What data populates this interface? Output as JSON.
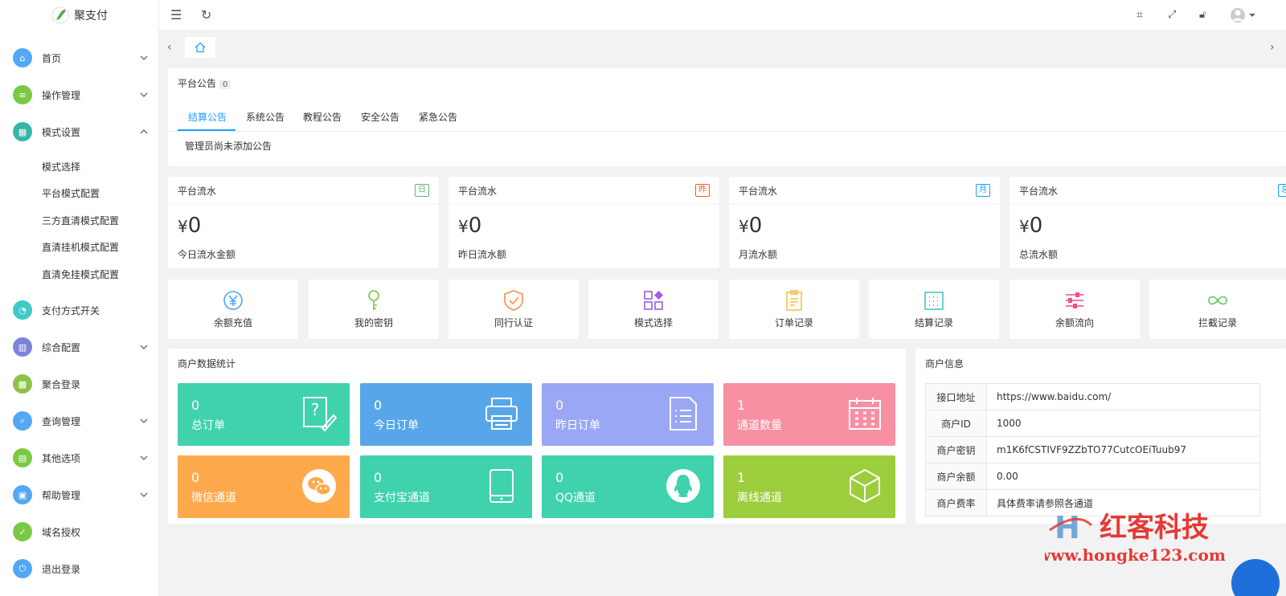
{
  "app": {
    "name": "聚支付"
  },
  "sidebar": {
    "items": [
      {
        "label": "首页",
        "color": "#52a8f5",
        "glyph": "⌂",
        "chevron": "down"
      },
      {
        "label": "操作管理",
        "color": "#7ac943",
        "glyph": "≡",
        "chevron": "down"
      },
      {
        "label": "模式设置",
        "color": "#36b5a8",
        "glyph": "▦",
        "chevron": "up"
      },
      {
        "label": "支付方式开关",
        "color": "#3fc9c9",
        "glyph": "◔",
        "chevron": ""
      },
      {
        "label": "综合配置",
        "color": "#7b84d9",
        "glyph": "▥",
        "chevron": "down"
      },
      {
        "label": "聚合登录",
        "color": "#8bc34a",
        "glyph": "▩",
        "chevron": ""
      },
      {
        "label": "查询管理",
        "color": "#52a8f5",
        "glyph": "⌕",
        "chevron": "down"
      },
      {
        "label": "其他选项",
        "color": "#7ac943",
        "glyph": "▤",
        "chevron": "down"
      },
      {
        "label": "帮助管理",
        "color": "#52a8f5",
        "glyph": "▣",
        "chevron": "down"
      },
      {
        "label": "域名授权",
        "color": "#7ac943",
        "glyph": "✓",
        "chevron": ""
      },
      {
        "label": "退出登录",
        "color": "#52a8f5",
        "glyph": "⏻",
        "chevron": ""
      }
    ],
    "subitems": [
      "模式选择",
      "平台模式配置",
      "三方直清模式配置",
      "直清挂机模式配置",
      "直清免挂模式配置"
    ]
  },
  "notice": {
    "title": "平台公告",
    "count": "0",
    "tabs": [
      "结算公告",
      "系统公告",
      "教程公告",
      "安全公告",
      "紧急公告"
    ],
    "content": "管理员尚未添加公告"
  },
  "stats": [
    {
      "title": "平台流水",
      "badge": "日",
      "badge_color": "#5fb878",
      "currency": "¥",
      "value": "0",
      "desc": "今日流水金额"
    },
    {
      "title": "平台流水",
      "badge": "昨",
      "badge_color": "#ff5722",
      "currency": "¥",
      "value": "0",
      "desc": "昨日流水额"
    },
    {
      "title": "平台流水",
      "badge": "月",
      "badge_color": "#1e9fff",
      "currency": "¥",
      "value": "0",
      "desc": "月流水额"
    },
    {
      "title": "平台流水",
      "badge": "总",
      "badge_color": "#01aaed",
      "currency": "¥",
      "value": "0",
      "desc": "总流水额"
    }
  ],
  "quick": [
    {
      "label": "余额充值",
      "icon": "yen-icon",
      "color": "#4da6ff"
    },
    {
      "label": "我的密钥",
      "icon": "key-icon",
      "color": "#7ac943"
    },
    {
      "label": "同行认证",
      "icon": "shield-check-icon",
      "color": "#ff8c4a"
    },
    {
      "label": "模式选择",
      "icon": "apps-icon",
      "color": "#9b5de5"
    },
    {
      "label": "订单记录",
      "icon": "clipboard-icon",
      "color": "#f5c04a"
    },
    {
      "label": "结算记录",
      "icon": "calendar-grid-icon",
      "color": "#3fc9c9"
    },
    {
      "label": "余额流向",
      "icon": "sliders-icon",
      "color": "#f54a8c"
    },
    {
      "label": "拦截记录",
      "icon": "infinity-icon",
      "color": "#5fc95f"
    }
  ],
  "merchant_stats": {
    "title": "商户数据统计",
    "tiles": [
      {
        "value": "0",
        "label": "总订单",
        "color": "#40d1ad",
        "icon": "note-edit-icon"
      },
      {
        "value": "0",
        "label": "今日订单",
        "color": "#58a6ea",
        "icon": "printer-icon"
      },
      {
        "value": "0",
        "label": "昨日订单",
        "color": "#9aa7f5",
        "icon": "document-list-icon"
      },
      {
        "value": "1",
        "label": "通道数量",
        "color": "#f790a2",
        "icon": "calendar-icon"
      },
      {
        "value": "0",
        "label": "微信通道",
        "color": "#ffa94d",
        "icon": "wechat-icon"
      },
      {
        "value": "0",
        "label": "支付宝通道",
        "color": "#40d1ad",
        "icon": "tablet-icon"
      },
      {
        "value": "0",
        "label": "QQ通道",
        "color": "#40d1ad",
        "icon": "qq-icon"
      },
      {
        "value": "1",
        "label": "离线通道",
        "color": "#9ccd3c",
        "icon": "cube-icon"
      }
    ]
  },
  "merchant_info": {
    "title": "商户信息",
    "rows": [
      {
        "key": "接口地址",
        "value": "https://www.baidu.com/"
      },
      {
        "key": "商户ID",
        "value": "1000"
      },
      {
        "key": "商户密钥",
        "value": "m1K6fCSTIVF9ZZbTO77CutcOEiTuub97"
      },
      {
        "key": "商户余额",
        "value": "0.00"
      },
      {
        "key": "商户费率",
        "value": "具体费率请参照各通道"
      }
    ]
  },
  "watermark": {
    "brand": "红客科技",
    "url": "www.hongke123.com"
  }
}
